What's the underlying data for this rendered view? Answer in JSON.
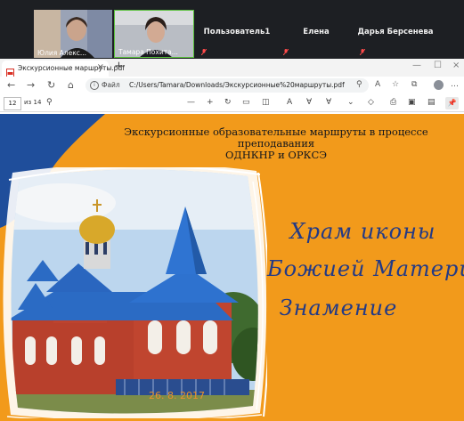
{
  "meeting": {
    "participants": [
      {
        "name": "Юлия Алекс..."
      },
      {
        "name": "Тамара Похита..."
      },
      {
        "name": "Пользователь1"
      },
      {
        "name": "Елена"
      },
      {
        "name": "Дарья Берсенева"
      }
    ]
  },
  "browser": {
    "tab_title": "Экскурсионные маршруты.pdf",
    "new_tab": "+",
    "url_label": "Файл",
    "url": "C:/Users/Tamara/Downloads/Экскурсионные%20маршруты.pdf"
  },
  "pdf_toolbar": {
    "page_number": "12",
    "page_total": "из 14"
  },
  "slide": {
    "heading_line1": "Экскурсионные образовательные маршруты в процессе преподавания",
    "heading_line2": "ОДНКНР и ОРКСЭ",
    "title_line1": "Храм иконы",
    "title_line2": "Божией Матери",
    "title_line3": "Знамение",
    "date": "26. 8. 2017"
  },
  "colors": {
    "slide_orange": "#f29a1b",
    "slide_blue": "#1f4e9b",
    "title_blue": "#233a86"
  }
}
